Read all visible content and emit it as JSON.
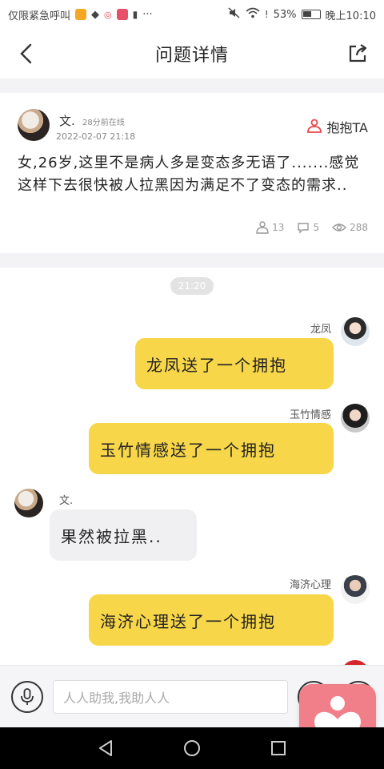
{
  "status_bar": {
    "carrier": "仅限紧急呼叫",
    "battery": "53%",
    "time": "晚上10:10",
    "more": "···"
  },
  "nav": {
    "title": "问题详情"
  },
  "question": {
    "author": "文.",
    "online": "28分前在线",
    "date": "2022-02-07 21:18",
    "hug_label": "抱抱TA",
    "text": "女,26岁,这里不是病人多是变态多无语了.......感觉这样下去很快被人拉黑因为满足不了变态的需求..",
    "hug_count": "13",
    "comment_count": "5",
    "view_count": "288"
  },
  "chat": {
    "time": "21:20",
    "messages": [
      {
        "side": "right",
        "name": "龙凤",
        "text": "龙凤送了一个拥抱"
      },
      {
        "side": "right",
        "name": "玉竹情感",
        "text": "玉竹情感送了一个拥抱"
      },
      {
        "side": "left",
        "name": "文.",
        "text": "果然被拉黑.."
      },
      {
        "side": "right",
        "name": "海济心理",
        "text": "海济心理送了一个拥抱"
      }
    ]
  },
  "input": {
    "placeholder": "人人助我,我助人人"
  },
  "colors": {
    "bubble_yellow": "#f7d64a",
    "bubble_gray": "#f0f0f3",
    "fab_pink": "#f07f8a",
    "hug_red": "#e5484d"
  }
}
